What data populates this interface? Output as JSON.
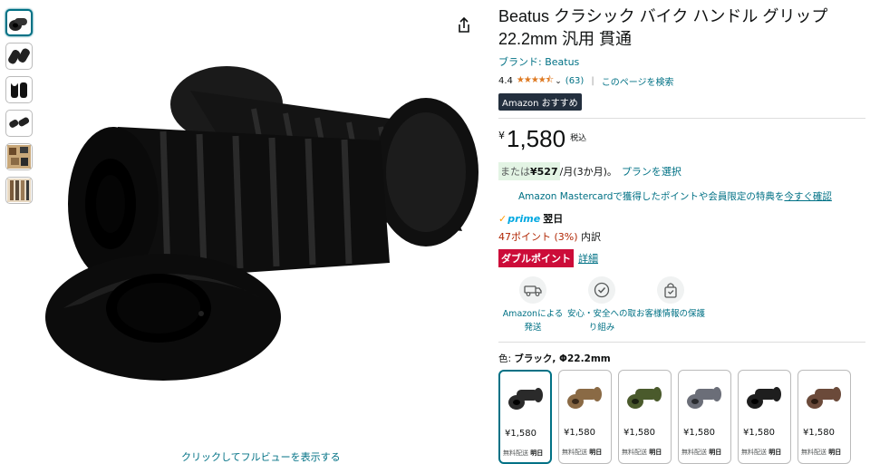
{
  "gallery": {
    "thumbnail_count": 6,
    "caption": "クリックしてフルビューを表示する"
  },
  "product": {
    "title": "Beatus クラシック バイク ハンドル グリップ 22.2mm 汎用 貫通",
    "brand": "ブランド: Beatus",
    "rating_value": "4.4",
    "stars_glyphs": "★★★★⯪",
    "review_count": "(63)",
    "search_page": "このページを検索",
    "badge_left": "Amazon",
    "badge_right": "おすすめ"
  },
  "price": {
    "currency": "¥",
    "amount": "1,580",
    "tax_note": "税込",
    "installment_prefix": "または",
    "installment_amount": "¥527",
    "installment_period": "/月(3か月)。",
    "plan_link": "プランを選択",
    "card_text": "Amazon Mastercardで獲得したポイントや会員限定の特典を",
    "card_link": "今すぐ確認",
    "prime_label": "prime",
    "delivery": "翌日",
    "points_text": "47ポイント (3%)",
    "points_suffix": "内訳",
    "double_points": "ダブルポイント",
    "detail_link": "詳細"
  },
  "features": [
    {
      "label": "Amazonによる発送",
      "icon": "truck-icon"
    },
    {
      "label": "安心・安全への取り組み",
      "icon": "shield-check-icon"
    },
    {
      "label": "お客様情報の保護",
      "icon": "bag-lock-icon"
    }
  ],
  "variation": {
    "label_prefix": "色:",
    "selected": "ブラック, Φ22.2mm",
    "options": [
      {
        "price": "¥1,580",
        "ship": "無料配送",
        "day": "明日",
        "color": "#2a2a2a"
      },
      {
        "price": "¥1,580",
        "ship": "無料配送",
        "day": "明日",
        "color": "#8a6a45"
      },
      {
        "price": "¥1,580",
        "ship": "無料配送",
        "day": "明日",
        "color": "#4a5a2c"
      },
      {
        "price": "¥1,580",
        "ship": "無料配送",
        "day": "明日",
        "color": "#6b6e78"
      },
      {
        "price": "¥1,580",
        "ship": "無料配送",
        "day": "明日",
        "color": "#1e1e1e"
      },
      {
        "price": "¥1,580",
        "ship": "無料配送",
        "day": "明日",
        "color": "#6b4a3a"
      }
    ]
  },
  "colors": {
    "link": "#007185",
    "price_red": "#b12704",
    "double_red": "#cc0c39",
    "star": "#de7921",
    "prime_blue": "#00a8e1"
  }
}
